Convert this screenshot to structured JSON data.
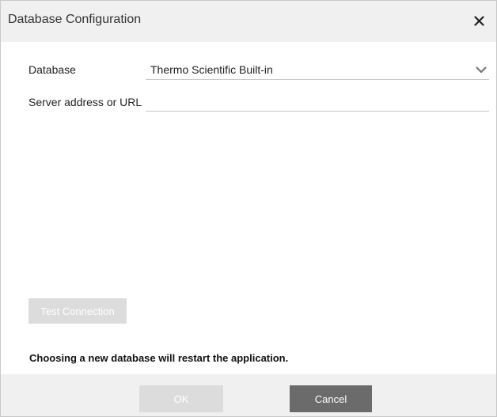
{
  "dialog": {
    "title": "Database Configuration",
    "close_icon": "close-icon"
  },
  "form": {
    "database_label": "Database",
    "database_value": "Thermo Scientific Built-in",
    "database_dropdown_icon": "chevron-down-icon",
    "server_label": "Server address or URL",
    "server_value": "",
    "server_placeholder": ""
  },
  "actions": {
    "test_connection_label": "Test Connection",
    "warning_text": "Choosing a new database will restart the application.",
    "ok_label": "OK",
    "cancel_label": "Cancel"
  },
  "colors": {
    "titlebar_bg": "#f0f0f0",
    "disabled_button": "#dcdcdc",
    "primary_button": "#6b6b6b",
    "divider": "#c8c8c8"
  }
}
